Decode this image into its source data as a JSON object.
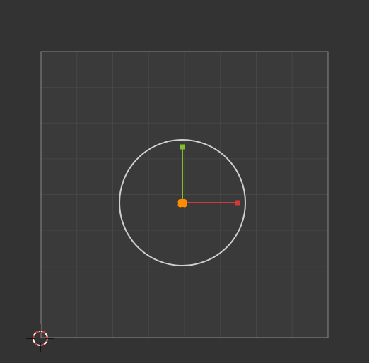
{
  "viewport": {
    "kind": "uv-editor-view",
    "background_color": "#333333",
    "image_area_color": "#3a3a3a",
    "image_border_color": "#8a8a8a",
    "grid_line_color": "#464646",
    "grid_divisions": 8
  },
  "selection_circle": {
    "color": "#cfcfcf"
  },
  "transform_gizmo": {
    "x_axis_color": "#d13a3a",
    "y_axis_color": "#7fbf2a",
    "pivot_color": "#ff8c00",
    "icon": "move-gizmo-icon"
  },
  "cursor_2d": {
    "icon": "2d-cursor-icon",
    "ring_color": "#ffffff",
    "dash_color": "#e63030",
    "crosshair_color": "#000000"
  }
}
